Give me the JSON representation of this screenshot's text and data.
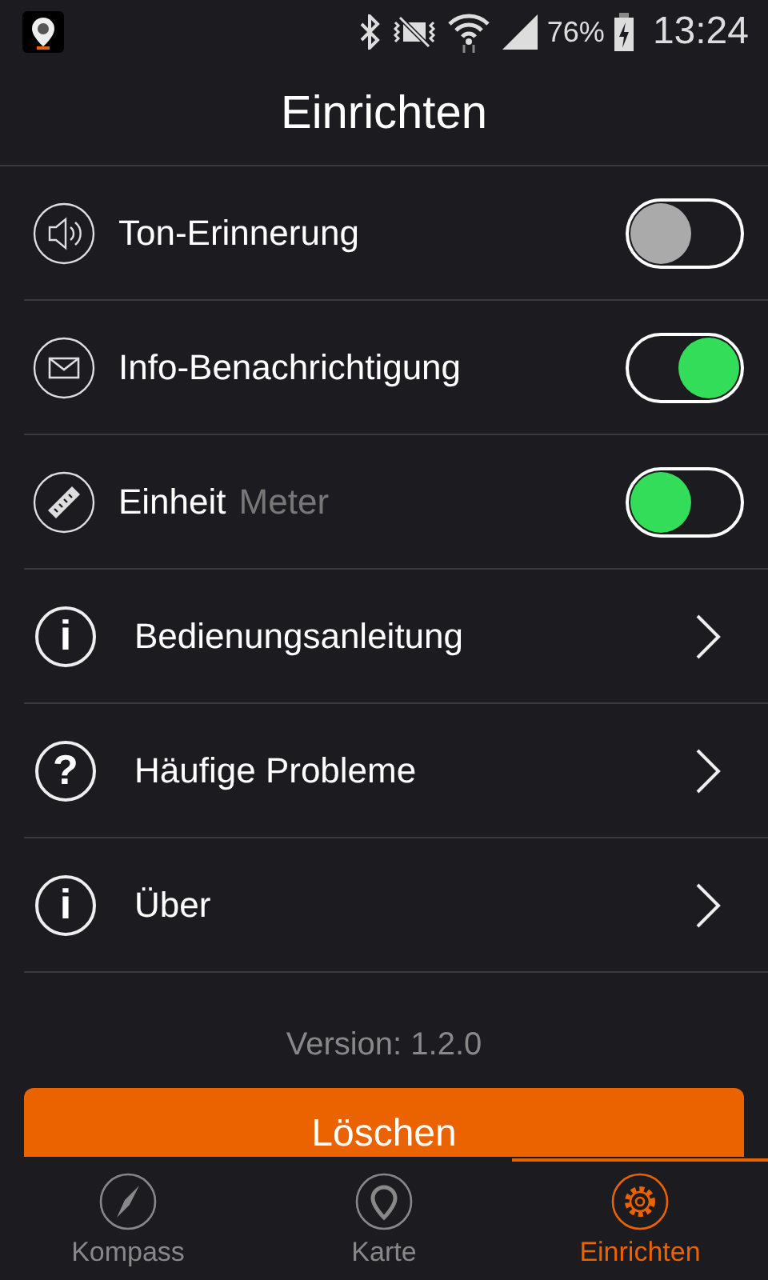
{
  "status_bar": {
    "battery_percent": "76%",
    "time": "13:24"
  },
  "title": "Einrichten",
  "settings": [
    {
      "kind": "toggle",
      "label": "Ton-Erinnerung",
      "on": false,
      "thumb_right": false
    },
    {
      "kind": "toggle",
      "label": "Info-Benachrichtigung",
      "on": true,
      "thumb_right": true
    },
    {
      "kind": "toggle",
      "label": "Einheit",
      "value": "Meter",
      "on": true,
      "thumb_right": false
    },
    {
      "kind": "link",
      "glyph": "i",
      "label": "Bedienungsanleitung"
    },
    {
      "kind": "link",
      "glyph": "?",
      "label": "Häufige Probleme"
    },
    {
      "kind": "link",
      "glyph": "i",
      "label": "Über"
    }
  ],
  "version": "Version: 1.2.0",
  "delete_button": "Löschen",
  "tabs": [
    {
      "label": "Kompass",
      "selected": false
    },
    {
      "label": "Karte",
      "selected": false
    },
    {
      "label": "Einrichten",
      "selected": true
    }
  ]
}
